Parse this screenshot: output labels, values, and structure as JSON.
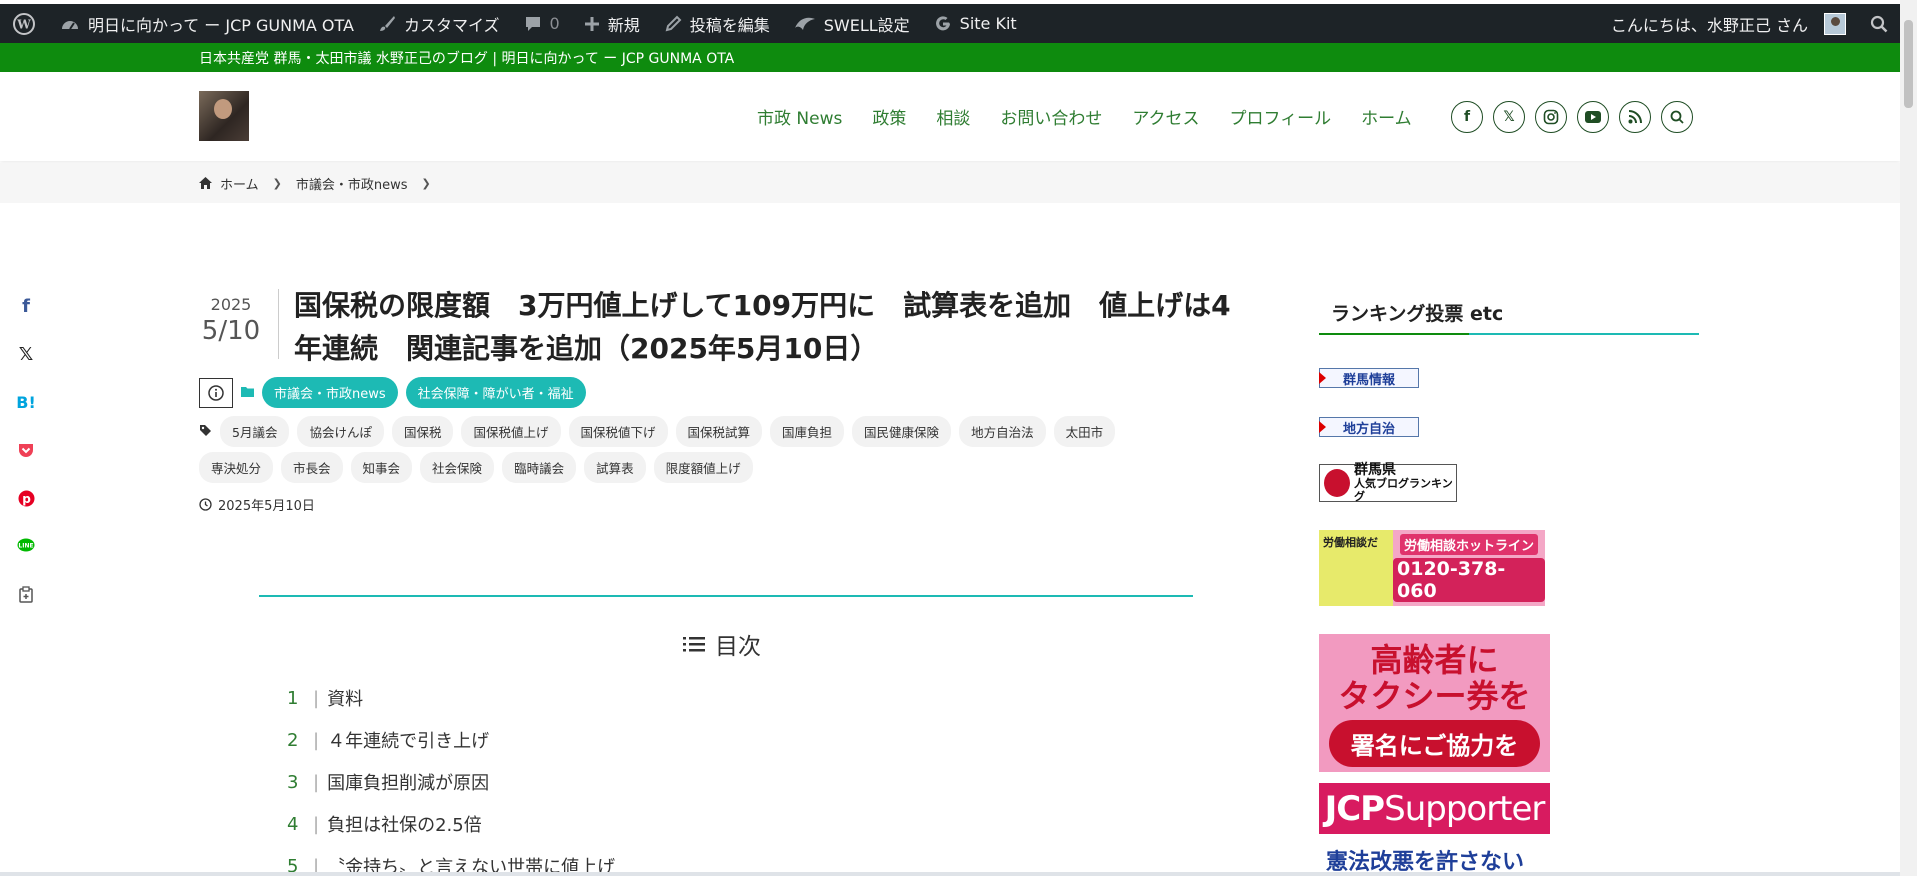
{
  "admin_bar": {
    "site_name": "明日に向かって ー JCP GUNMA OTA",
    "customize": "カスタマイズ",
    "comments_count": "0",
    "new": "新規",
    "edit_post": "投稿を編集",
    "swell_settings": "SWELL設定",
    "site_kit": "Site Kit",
    "greeting": "こんにちは、水野正己 さん"
  },
  "notice_bar": "日本共産党 群馬・太田市議 水野正己のブログ | 明日に向かって ー JCP GUNMA OTA",
  "nav": {
    "items": [
      "市政 News",
      "政策",
      "相談",
      "お問い合わせ",
      "アクセス",
      "プロフィール",
      "ホーム"
    ],
    "sns_icons": [
      "facebook-icon",
      "x-icon",
      "instagram-icon",
      "youtube-icon",
      "rss-icon",
      "search-icon"
    ]
  },
  "breadcrumb": {
    "home": "ホーム",
    "category": "市議会・市政news"
  },
  "article": {
    "year": "2025",
    "month_day": "5/10",
    "title": "国保税の限度額　3万円値上げして109万円に　試算表を追加　値上げは4年連続　関連記事を追加（2025年5月10日）",
    "categories": [
      "市議会・市政news",
      "社会保障・障がい者・福祉"
    ],
    "tags_row1": [
      "5月議会",
      "協会けんぽ",
      "国保税",
      "国保税値上げ",
      "国保税値下げ",
      "国保税試算",
      "国庫負担",
      "国民健康保険",
      "地方自治法",
      "太田市"
    ],
    "tags_row2": [
      "専決処分",
      "市長会",
      "知事会",
      "社会保険",
      "臨時議会",
      "試算表",
      "限度額値上げ"
    ],
    "published": "2025年5月10日"
  },
  "toc": {
    "title": "目次",
    "items": [
      {
        "num": "1",
        "label": "資料"
      },
      {
        "num": "2",
        "label": "４年連続で引き上げ"
      },
      {
        "num": "3",
        "label": "国庫負担削減が原因"
      },
      {
        "num": "4",
        "label": "負担は社保の2.5倍"
      },
      {
        "num": "5",
        "label": "〝金持ち〟と言えない世帯に値上げ"
      }
    ]
  },
  "share_icons": [
    "facebook-icon",
    "x-icon",
    "hatena-bookmark-icon",
    "pocket-icon",
    "pinterest-icon",
    "line-icon",
    "copy-icon"
  ],
  "sidebar": {
    "title": "ランキング投票 etc",
    "banner_gunma_info": "群馬情報",
    "banner_local_gov": "地方自治",
    "banner_gunma_rank_top": "群馬県",
    "banner_gunma_rank_bottom": "人気ブログランキング",
    "banner_labor_left": "労働相談だ",
    "banner_labor_title": "労働相談ホットライン",
    "banner_labor_phone": "0120-378-060",
    "banner_taxi_line1": "高齢者に",
    "banner_taxi_line2": "タクシー券を",
    "banner_taxi_line3": "署名にご協力を",
    "banner_jcp_a": "JCP",
    "banner_jcp_b": "Supporter",
    "banner_kenpo": "憲法改悪を許さない"
  },
  "colors": {
    "admin_bar": "#1d2327",
    "notice_bar": "#0e8b0e",
    "nav_link": "#2f7d32",
    "accent_teal": "#1dbab4"
  }
}
